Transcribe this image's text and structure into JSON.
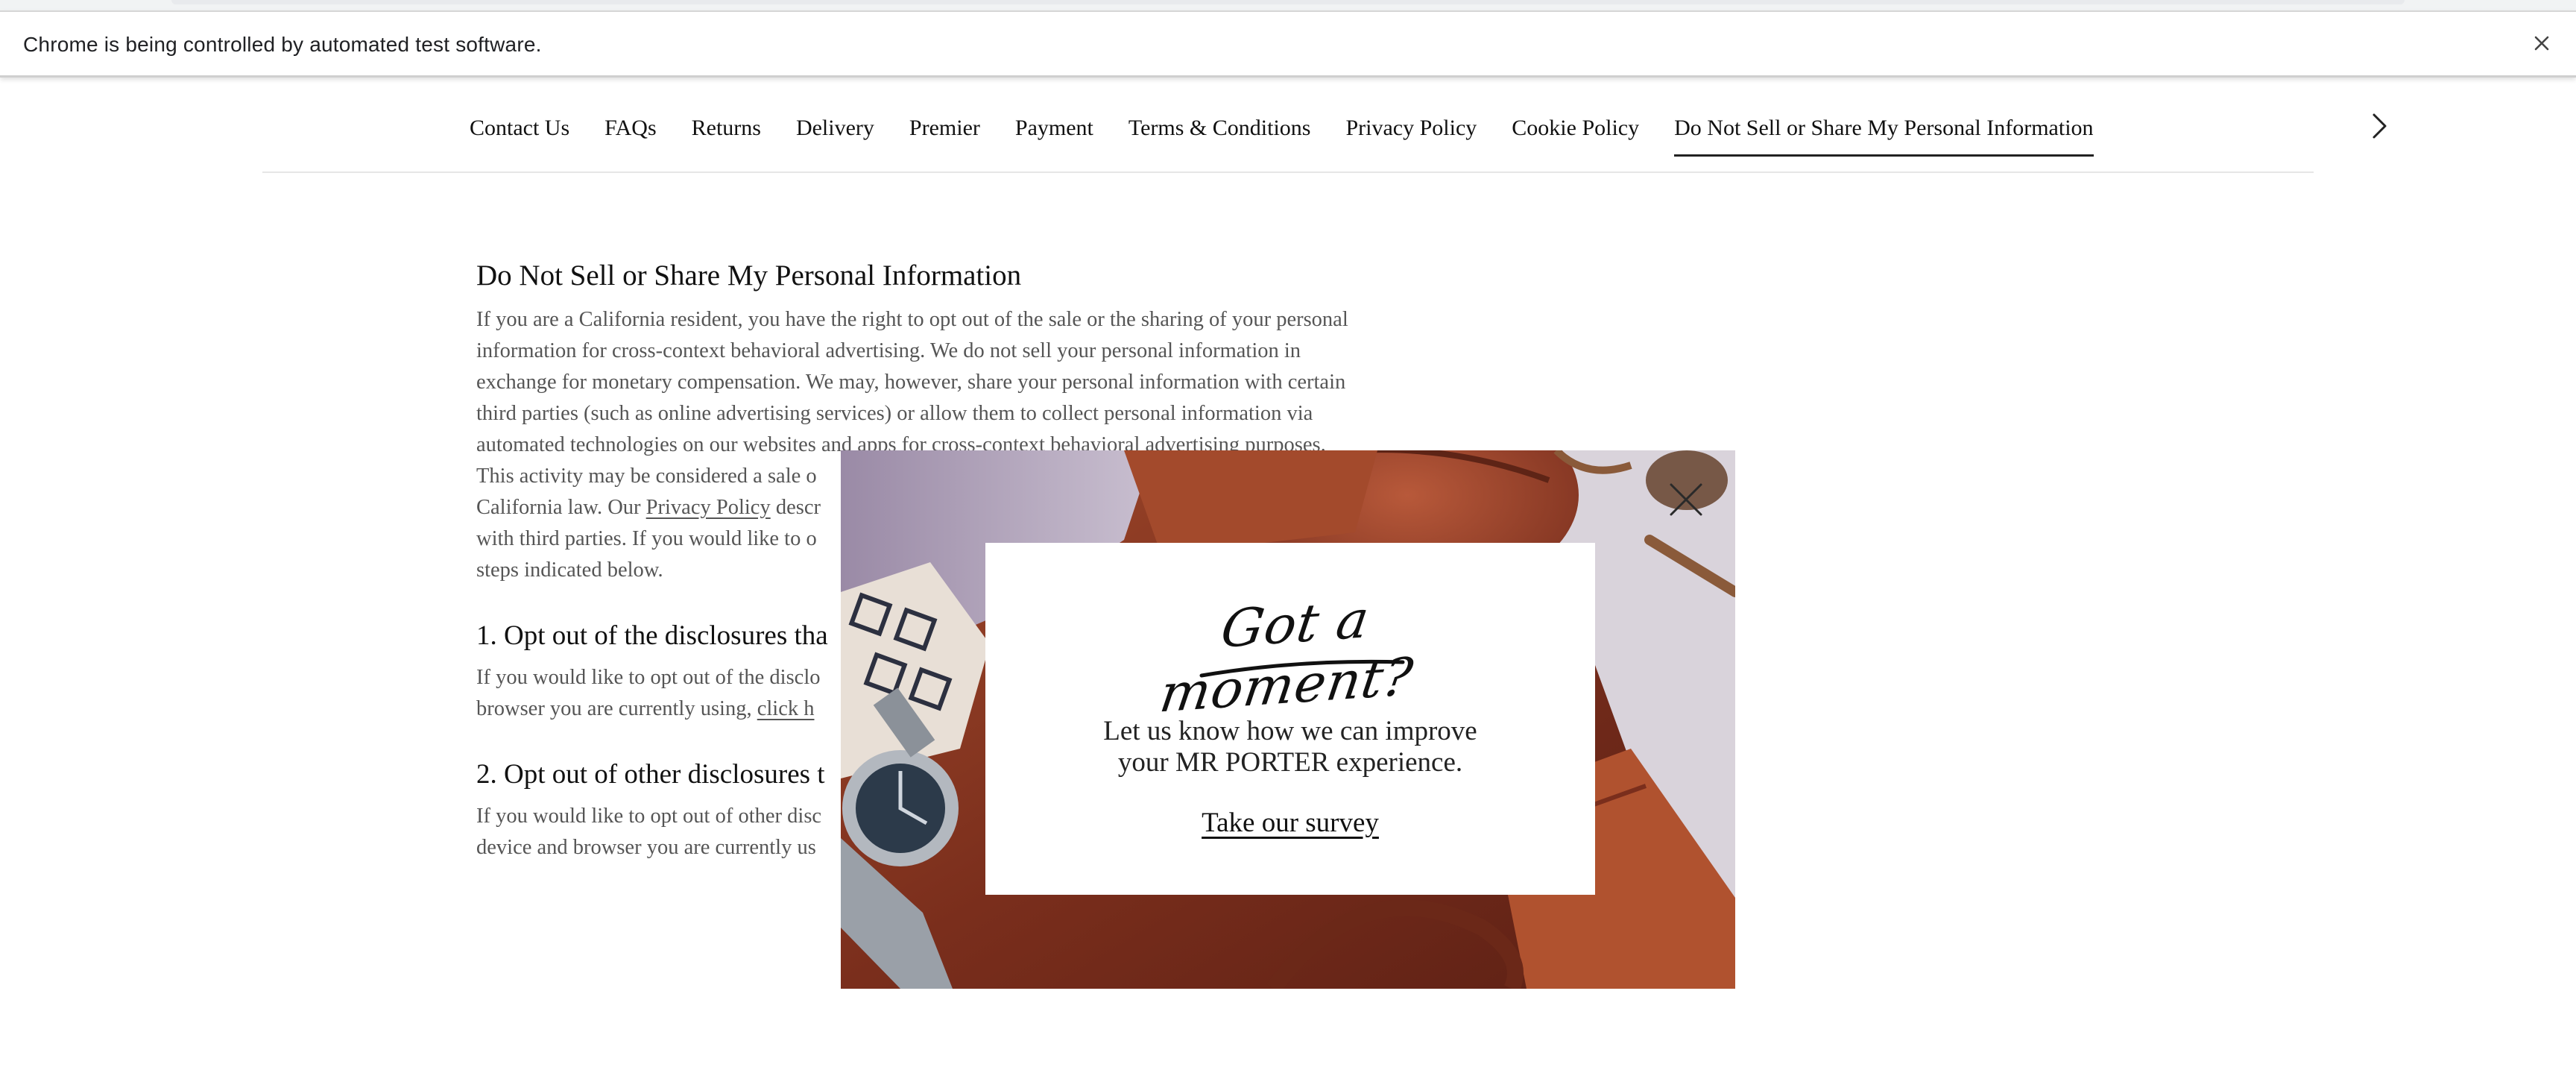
{
  "browser": {
    "automation_message": "Chrome is being controlled by automated test software."
  },
  "help_nav": {
    "items": [
      {
        "label": "Contact Us"
      },
      {
        "label": "FAQs"
      },
      {
        "label": "Returns"
      },
      {
        "label": "Delivery"
      },
      {
        "label": "Premier"
      },
      {
        "label": "Payment"
      },
      {
        "label": "Terms & Conditions"
      },
      {
        "label": "Privacy Policy"
      },
      {
        "label": "Cookie Policy"
      },
      {
        "label": "Do Not Sell or Share My Personal Information"
      }
    ],
    "active_index": 9
  },
  "article": {
    "title": "Do Not Sell or Share My Personal Information",
    "intro_line_1": "If you are a California resident, you have the right to opt out of the sale or the sharing of your personal",
    "intro_line_2": "information for cross-context behavioral advertising. We do not sell your personal information in",
    "intro_line_3": "exchange for monetary compensation. We may, however, share your personal information with certain",
    "intro_line_4": "third parties (such as online advertising services) or allow them to collect personal information via",
    "intro_line_5": "automated technologies on our websites and apps for cross-context behavioral advertising purposes.",
    "intro_line_6": "This activity may be considered a sale o",
    "intro_line_7_before": "California law. Our ",
    "privacy_link": "Privacy Policy",
    "intro_line_7_after": " descr",
    "intro_line_8": "with third parties. If you would like to o",
    "intro_line_9": "steps indicated below.",
    "section_1_title": "1. Opt out of the disclosures tha",
    "section_1_line_1": "If you would like to opt out of the disclo",
    "section_1_line_2_before": "browser you are currently using, ",
    "section_1_link": "click h",
    "section_2_title": "2. Opt out of other disclosures t",
    "section_2_line_1": "If you would like to opt out of other disc",
    "section_2_line_2": "device and browser you are currently us"
  },
  "survey_popup": {
    "headline": "Got a moment?",
    "body_line_1": "Let us know how we can improve",
    "body_line_2": "your MR PORTER experience.",
    "cta": "Take our survey"
  },
  "colors": {
    "leather": "#8e3a24",
    "card": "#ffffff",
    "text_muted": "#555555"
  }
}
